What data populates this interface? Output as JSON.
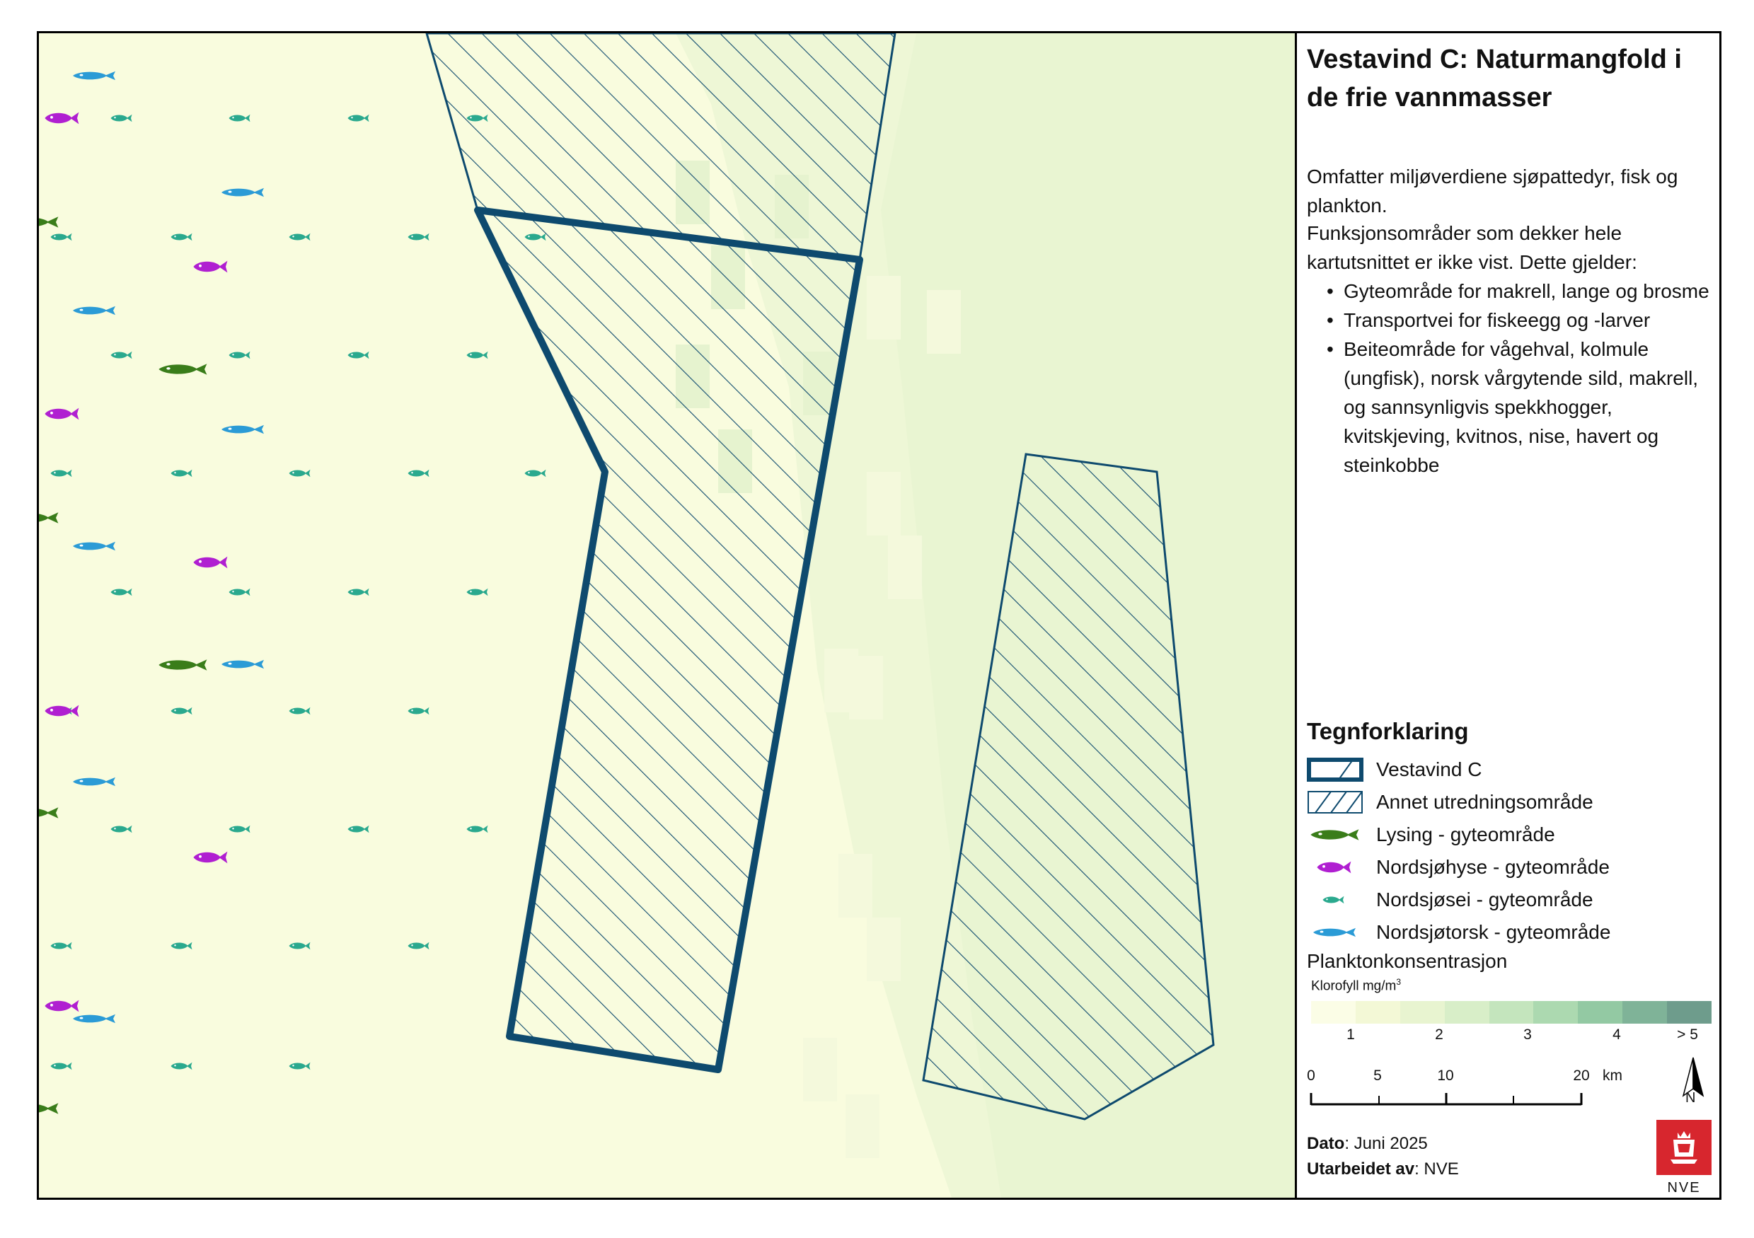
{
  "title": "Vestavind C: Naturmangfold i de frie vannmasser",
  "description1": "Omfatter miljøverdiene sjøpattedyr, fisk og plankton.",
  "description2": "Funksjonsområder som dekker hele kartutsnittet er ikke vist. Dette gjelder:",
  "bullets": [
    "Gyteområde for makrell, lange og brosme",
    "Transportvei for fiskeegg og -larver",
    "Beiteområde for vågehval, kolmule (ungfisk), norsk vårgytende sild, makrell, og sannsynligvis spekkhogger, kvitskjeving, kvitnos, nise, havert og steinkobbe"
  ],
  "legend": {
    "title": "Tegnforklaring",
    "items": [
      {
        "label": "Vestavind C",
        "symbol": "thick-hatched-polygon"
      },
      {
        "label": "Annet utredningsområde",
        "symbol": "thin-hatched-polygon"
      },
      {
        "label": "Lysing - gyteområde",
        "symbol": "fish-icon",
        "color": "#3a7d1a"
      },
      {
        "label": "Nordsjøhyse - gyteområde",
        "symbol": "fish-icon",
        "color": "#b01fd1"
      },
      {
        "label": "Nordsjøsei - gyteområde",
        "symbol": "fish-icon",
        "color": "#2aa98e"
      },
      {
        "label": "Nordsjøtorsk - gyteområde",
        "symbol": "fish-icon",
        "color": "#2b9bd6"
      }
    ]
  },
  "plankton": {
    "title": "Planktonkonsentrasjon",
    "unit_prefix": "Klorofyll mg/m",
    "unit_sup": "3",
    "ramp_colors": [
      "#fbfde6",
      "#f3f8d6",
      "#e8f4d0",
      "#d8eec8",
      "#c4e5bd",
      "#acd9b0",
      "#93c9a3",
      "#7fb398",
      "#6e9c8c"
    ],
    "ramp_labels": [
      "1",
      "2",
      "3",
      "4",
      "> 5"
    ]
  },
  "scalebar": {
    "labels": [
      "0",
      "5",
      "10",
      "20"
    ],
    "unit": "km"
  },
  "north": "N",
  "date_label": "Dato",
  "date_value": ": Juni 2025",
  "author_label": "Utarbeidet av",
  "author_value": ": NVE",
  "logo_text": "NVE",
  "colors": {
    "sea_light": "#f8fbdc",
    "sea_mid": "#f1f8da",
    "sea_green": "#e8f5d3",
    "outline": "#0e4a6e"
  }
}
